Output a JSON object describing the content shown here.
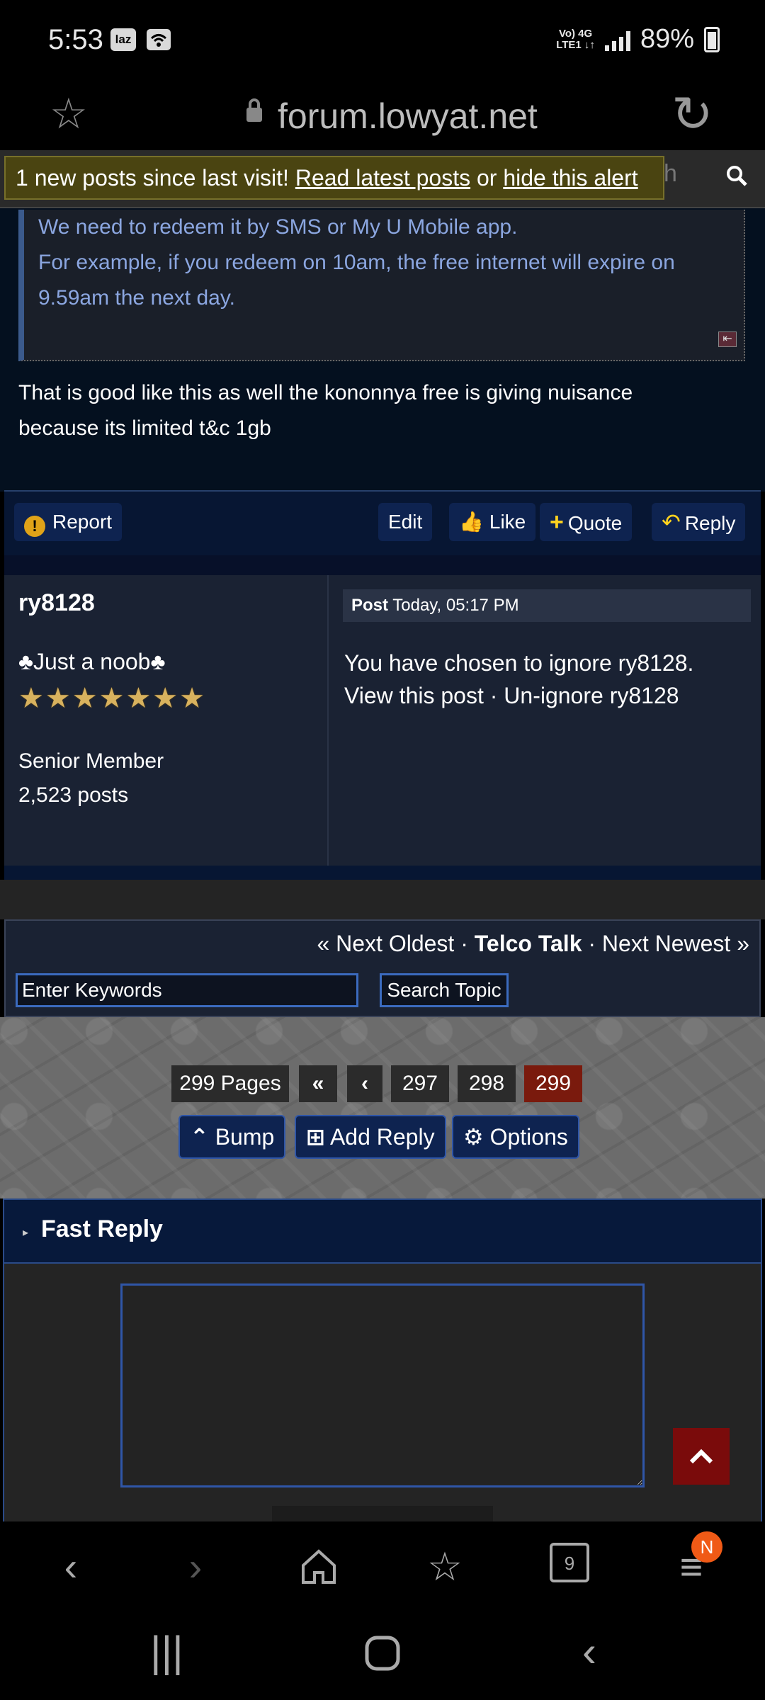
{
  "status_bar": {
    "time": "5:53",
    "icons": [
      "laz-icon",
      "wifi-icon"
    ],
    "network_top": "Vo) 4G",
    "network_bottom": "LTE1 ↓↑",
    "battery": "89%"
  },
  "browser": {
    "url": "forum.lowyat.net",
    "tab_count": "9",
    "menu_badge": "N"
  },
  "forum_nav": {
    "search_ghost_text": "ch"
  },
  "alert": {
    "text": "1 new posts since last visit!",
    "link1": "Read latest posts",
    "middle": "or",
    "link2": "hide this alert"
  },
  "quote": {
    "lines": [
      "We need to redeem it by SMS or My U Mobile app.",
      "For example, if you redeem on 10am, the free internet will expire on",
      "9.59am the next day."
    ]
  },
  "reply": {
    "lines": [
      "That is good like this as well the kononnya free is giving nuisance",
      "because its limited t&c 1gb"
    ]
  },
  "actions": {
    "report": "Report",
    "edit": "Edit",
    "like": "Like",
    "quote": "Quote",
    "reply": "Reply"
  },
  "ignored_post": {
    "username": "ry8128",
    "user_title": "♣Just a noob♣",
    "stars": 7,
    "rank": "Senior Member",
    "posts": "2,523 posts",
    "post_label": "Post",
    "post_time": "Today, 05:17 PM",
    "line1": "You have chosen to ignore ry8128.",
    "line2": "View this post · Un-ignore ry8128"
  },
  "topic_nav": {
    "prev": "« Next Oldest",
    "sep": "·",
    "topic": "Telco Talk",
    "next": "Next Newest »",
    "keyword_placeholder": "Enter Keywords",
    "search_button": "Search Topic"
  },
  "pagination": {
    "pages_label": "299 Pages",
    "first": "«",
    "prev": "‹",
    "pages": [
      "297",
      "298",
      "299"
    ],
    "current": "299"
  },
  "topic_actions": {
    "bump": "Bump",
    "add_reply": "Add Reply",
    "options": "Options"
  },
  "fast_reply": {
    "title": "Fast Reply"
  },
  "colors": {
    "accent": "#3b6bbf",
    "active_page": "#7a1a0d",
    "alert_bg": "#4a4411"
  }
}
